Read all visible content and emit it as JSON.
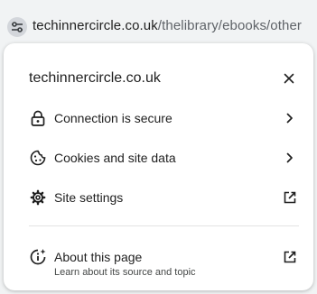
{
  "omnibox": {
    "domain": "techinnercircle.co.uk",
    "path": "/thelibrary/ebooks/other",
    "site_info_icon": "tune-icon"
  },
  "site_info": {
    "title": "techinnercircle.co.uk",
    "close_icon": "close-icon",
    "items": [
      {
        "label": "Connection is secure",
        "icon": "lock-icon",
        "trailing_icon": "chevron-right-icon"
      },
      {
        "label": "Cookies and site data",
        "icon": "cookie-icon",
        "trailing_icon": "chevron-right-icon"
      },
      {
        "label": "Site settings",
        "icon": "gear-icon",
        "trailing_icon": "open-external-icon"
      }
    ],
    "about": {
      "label": "About this page",
      "sublabel": "Learn about its source and topic",
      "icon": "about-page-icon",
      "trailing_icon": "open-external-icon"
    }
  },
  "colors": {
    "toolbar_bg": "#f1f3f4",
    "popup_bg": "#ffffff",
    "text": "#1f1f1f",
    "secondary_text": "#5f6368"
  }
}
